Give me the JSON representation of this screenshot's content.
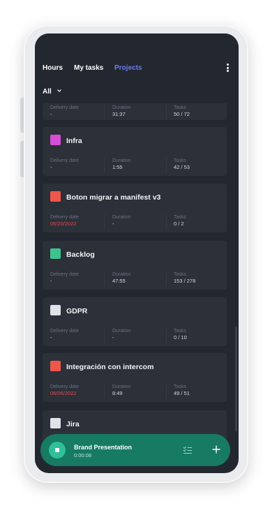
{
  "tabs": [
    {
      "label": "Hours"
    },
    {
      "label": "My tasks"
    },
    {
      "label": "Projects"
    }
  ],
  "filter": {
    "label": "All"
  },
  "stat_labels": {
    "delivery": "Delivery date",
    "duration": "Duration",
    "tasks": "Tasks"
  },
  "projects": [
    {
      "name": "",
      "color": "#2b3039",
      "delivery": "-",
      "delivery_late": false,
      "duration": "31:37",
      "tasks": "50 / 72"
    },
    {
      "name": "Infra",
      "color": "#d54fd6",
      "delivery": "-",
      "delivery_late": false,
      "duration": "1:55",
      "tasks": "42 / 53"
    },
    {
      "name": "Boton migrar a manifest v3",
      "color": "#f0574b",
      "delivery": "06/20/2022",
      "delivery_late": true,
      "duration": "-",
      "tasks": "0 / 2"
    },
    {
      "name": "Backlog",
      "color": "#3cc48f",
      "delivery": "-",
      "delivery_late": false,
      "duration": "47:55",
      "tasks": "153 / 278"
    },
    {
      "name": "GDPR",
      "color": "#dfe2e7",
      "delivery": "-",
      "delivery_late": false,
      "duration": "-",
      "tasks": "0 / 10"
    },
    {
      "name": "Integración con intercom",
      "color": "#f0574b",
      "delivery": "06/06/2022",
      "delivery_late": true,
      "duration": "8:49",
      "tasks": "49 / 51"
    },
    {
      "name": "Jira",
      "color": "#dfe2e7",
      "delivery": "",
      "delivery_late": false,
      "duration": "",
      "tasks": ""
    }
  ],
  "player": {
    "title": "Brand Presentation",
    "time": "0:00:08"
  },
  "icons": {
    "menu": "more-vertical-icon",
    "filter": "chevron-down-icon",
    "stop": "stop-icon",
    "tasks": "checklist-icon",
    "add": "plus-icon"
  }
}
